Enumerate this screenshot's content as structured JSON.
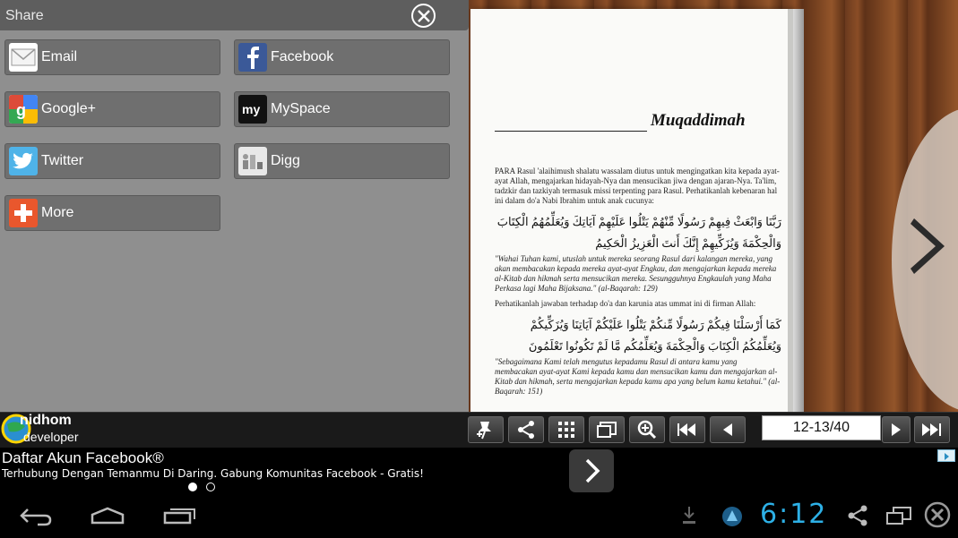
{
  "share": {
    "title": "Share",
    "items": [
      {
        "label": "Email",
        "icon": "email-icon"
      },
      {
        "label": "Facebook",
        "icon": "facebook-icon"
      },
      {
        "label": "Google+",
        "icon": "google-plus-icon"
      },
      {
        "label": "MySpace",
        "icon": "myspace-icon"
      },
      {
        "label": "Twitter",
        "icon": "twitter-icon"
      },
      {
        "label": "Digg",
        "icon": "digg-icon"
      },
      {
        "label": "More",
        "icon": "plus-icon"
      }
    ]
  },
  "book": {
    "heading": "Muqaddimah",
    "para1": "PARA Rasul 'alaihimush shalatu wassalam diutus untuk mengingatkan kita kepada ayat-ayat Allah, mengajarkan hidayah-Nya dan mensucikan jiwa dengan ajaran-Nya. Ta'lim, tadzkir dan tazkiyah termasuk missi terpenting para Rasul. Perhatikanlah kebenaran hal ini dalam do'a Nabi Ibrahim untuk anak cucunya:",
    "arabic1": "رَبَّنَا وَابْعَثْ فِيهِمْ رَسُولًا مِّنْهُمْ يَتْلُوا عَلَيْهِمْ آيَاتِكَ وَيُعَلِّمُهُمُ الْكِتَابَ",
    "arabic2": "وَالْحِكْمَةَ وَيُزَكِّيهِمْ إِنَّكَ أَنتَ الْعَزِيزُ الْحَكِيمُ",
    "trans1": "\"Wahai Tuhan kami, utuslah untuk mereka seorang Rasul dari kalangan mereka, yang akan membacakan kepada mereka ayat-ayat Engkau, dan mengajarkan kepada mereka al-Kitab dan hikmah serta mensucikan mereka. Sesungguhnya Engkaulah yang Maha Perkasa lagi Maha Bijaksana.\" (al-Baqarah: 129)",
    "para2": "Perhatikanlah jawaban terhadap do'a dan karunia atas ummat ini di firman Allah:",
    "arabic3": "كَمَا أَرْسَلْنَا فِيكُمْ رَسُولًا مِّنكُمْ يَتْلُوا عَلَيْكُمْ آيَاتِنَا وَيُزَكِّيكُمْ",
    "arabic4": "وَيُعَلِّمُكُمُ الْكِتَابَ وَالْحِكْمَةَ وَيُعَلِّمُكُم مَّا لَمْ تَكُونُوا تَعْلَمُونَ",
    "trans2": "\"Sebagaimana Kami telah mengutus kepadamu Rasul di antara kamu yang membacakan ayat-ayat Kami kepada kamu dan mensucikan kamu dan mengajarkan al-Kitab dan hikmah, serta mengajarkan kepada kamu apa yang belum kamu ketahui.\" (al-Baqarah: 151)"
  },
  "toolbar": {
    "page_indicator": "12-13/40",
    "logo_line1": "nidhom",
    "logo_line2": "developer"
  },
  "ad": {
    "title": "Daftar Akun Facebook®",
    "subtitle": "Terhubung Dengan Temanmu Di Daring. Gabung Komunitas Facebook - Gratis!"
  },
  "status": {
    "clock": "6:12"
  },
  "colors": {
    "clock": "#2db0e6",
    "panel": "#8f8f8f",
    "button": "#6f6f6f"
  }
}
